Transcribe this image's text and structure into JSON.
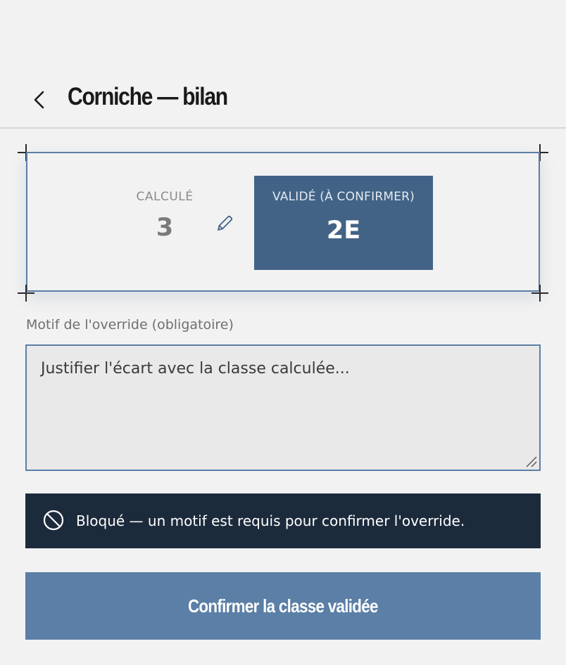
{
  "header": {
    "title": "Corniche — bilan",
    "back_icon": "chevron-left-icon"
  },
  "classification": {
    "computed_label": "CALCULÉ",
    "computed_value": "3",
    "edit_icon": "pencil-icon",
    "validated_label": "VALIDÉ (À CONFIRMER)",
    "validated_value": "2E"
  },
  "override": {
    "label": "Motif de l'override (obligatoire)",
    "value": "",
    "placeholder": "Justifier l'écart avec la classe calculée..."
  },
  "alert": {
    "icon": "blocked-icon",
    "message": "Bloqué — un motif est requis pour confirmer l'override."
  },
  "actions": {
    "confirm_label": "Confirmer la classe validée"
  },
  "colors": {
    "background": "#f2f2f2",
    "accent_border": "#5b7ea6",
    "validated_bg": "#426385",
    "alert_bg": "#1c2b3c",
    "button_bg": "#5b7fa6"
  }
}
